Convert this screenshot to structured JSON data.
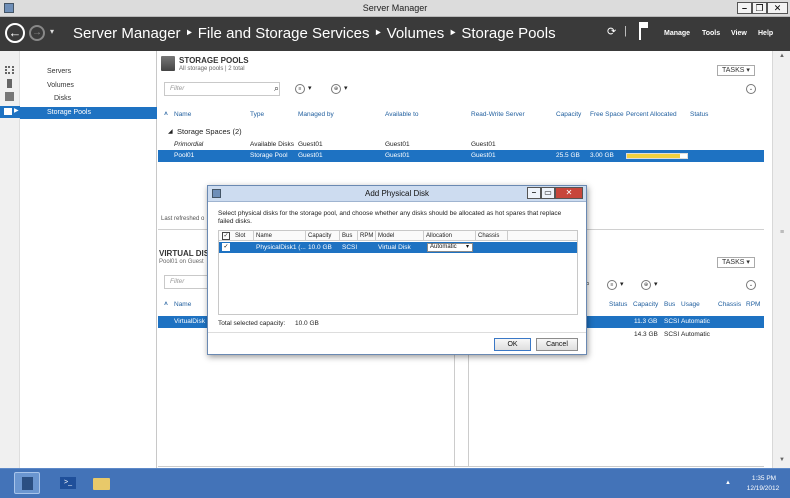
{
  "window": {
    "title": "Server Manager",
    "min": "–",
    "max": "❐",
    "close": "✕"
  },
  "navbar": {
    "breadcrumb": "Server Manager  ‣  File and Storage Services  ‣  Volumes  ‣  Storage Pools",
    "menus": [
      "Manage",
      "Tools",
      "View",
      "Help"
    ],
    "separator": "|"
  },
  "sidebar": {
    "items": [
      {
        "label": "Servers"
      },
      {
        "label": "Volumes"
      },
      {
        "label": "Disks"
      },
      {
        "label": "Storage Pools"
      }
    ]
  },
  "pools": {
    "title": "STORAGE POOLS",
    "subtitle": "All storage pools | 2 total",
    "tasks": "TASKS",
    "filter_placeholder": "Filter",
    "columns": [
      "Name",
      "Type",
      "Managed by",
      "Available to",
      "Read-Write Server",
      "Capacity",
      "Free Space",
      "Percent Allocated",
      "Status"
    ],
    "group": "Storage Spaces (2)",
    "rows": [
      {
        "name": "Primordial",
        "type": "Available Disks",
        "managed_by": "Guest01",
        "available_to": "Guest01",
        "rw_server": "Guest01",
        "capacity": "",
        "free_space": "",
        "percent": null
      },
      {
        "name": "Pool01",
        "type": "Storage Pool",
        "managed_by": "Guest01",
        "available_to": "Guest01",
        "rw_server": "Guest01",
        "capacity": "25.5 GB",
        "free_space": "3.00 GB",
        "percent": 88
      }
    ],
    "last_refreshed": "Last refreshed o"
  },
  "vdisks": {
    "title": "VIRTUAL DISK",
    "subtitle": "Pool01 on Guest",
    "filter_placeholder": "Filter",
    "col_name": "Name",
    "row_name": "VirtualDisk"
  },
  "pdisks": {
    "tasks": "TASKS",
    "columns": [
      "Status",
      "Capacity",
      "Bus",
      "Usage",
      "Chassis",
      "RPM"
    ],
    "rows": [
      {
        "capacity": "11.3 GB",
        "bus": "SCSI",
        "usage": "Automatic"
      },
      {
        "capacity": "14.3 GB",
        "bus": "SCSI",
        "usage": "Automatic"
      }
    ]
  },
  "dialog": {
    "title": "Add Physical Disk",
    "instructions": "Select physical disks for the storage pool, and choose whether any disks should be allocated as hot spares that replace failed disks.",
    "columns": [
      "Slot",
      "Name",
      "Capacity",
      "Bus",
      "RPM",
      "Model",
      "Allocation",
      "Chassis"
    ],
    "rows": [
      {
        "checked": true,
        "slot": "",
        "name": "PhysicalDisk1 (...",
        "capacity": "10.0 GB",
        "bus": "SCSI",
        "rpm": "",
        "model": "Virtual Disk",
        "allocation": "Automatic",
        "chassis": ""
      }
    ],
    "total_label": "Total selected capacity:",
    "total_value": "10.0 GB",
    "ok": "OK",
    "cancel": "Cancel"
  },
  "taskbar": {
    "time": "1:35 PM",
    "date": "12/19/2012"
  },
  "colors": {
    "nav": "#3a3a3a",
    "selection": "#1e72c2",
    "taskbar": "#4373b8",
    "allocated": "#f0d040"
  }
}
